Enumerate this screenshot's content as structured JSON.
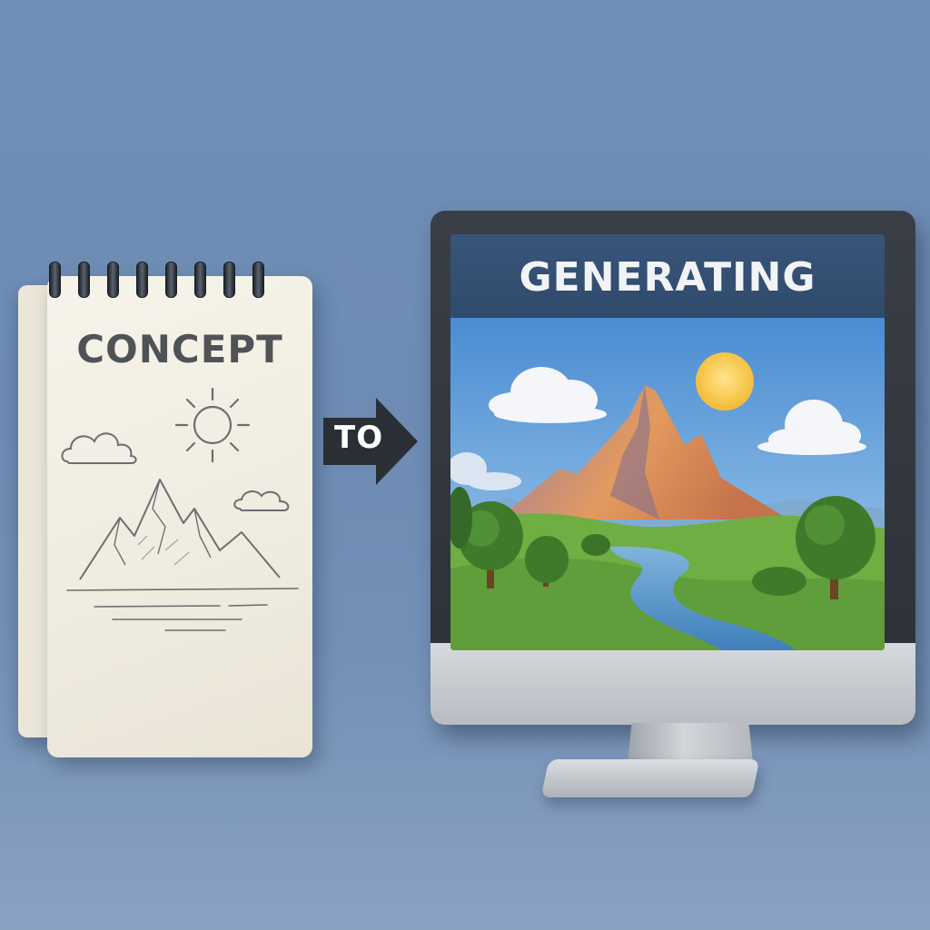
{
  "notepad": {
    "title": "CONCEPT",
    "sketch": [
      "sun-icon",
      "cloud-icon",
      "mountain-icon"
    ]
  },
  "arrow": {
    "label": "TO",
    "color": "#2a2f36"
  },
  "monitor": {
    "header_text": "GENERATING",
    "scene": [
      "sun",
      "clouds",
      "mountain",
      "river",
      "trees",
      "grass"
    ]
  },
  "colors": {
    "background": "#6d8bb3",
    "screen_header": "#2f4a6b",
    "sky": "#5b9bd8",
    "sun": "#f7c84a",
    "grass": "#5f9e3a",
    "river": "#4f8fc6"
  }
}
